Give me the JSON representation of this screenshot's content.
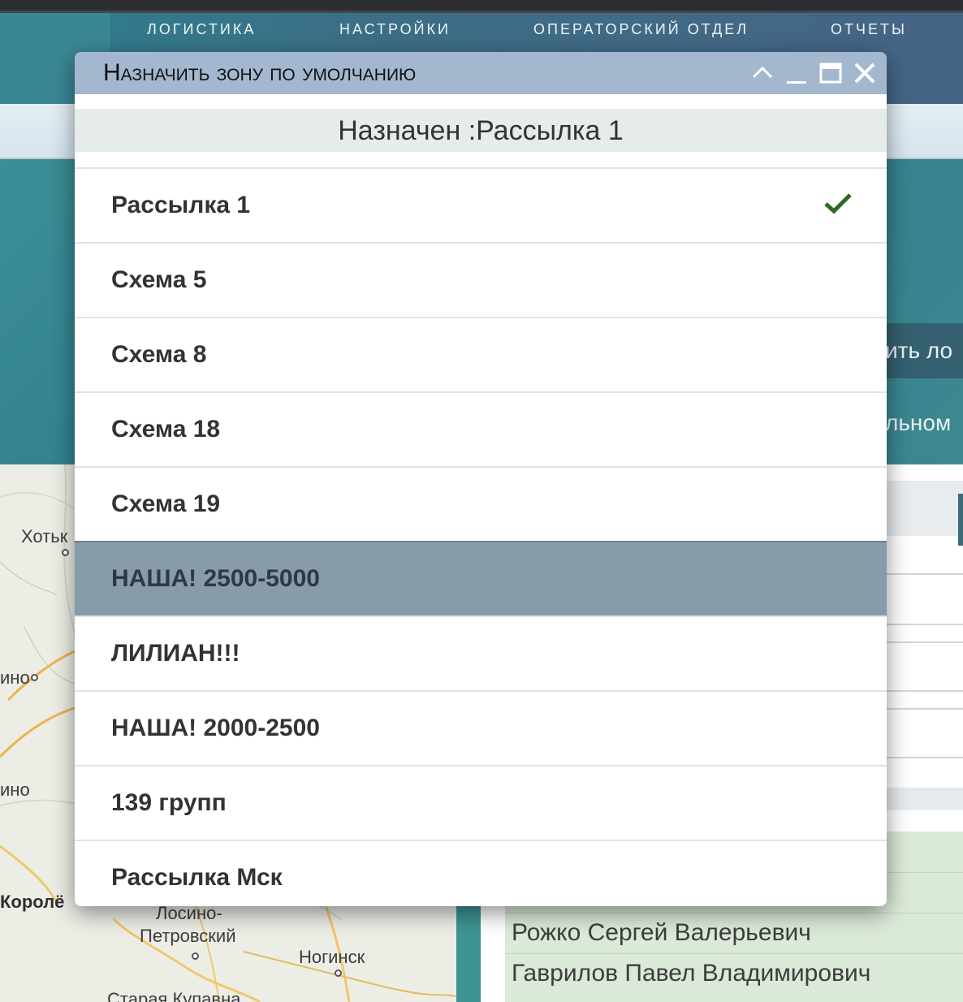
{
  "nav": {
    "items": [
      "ЛОГИСТИКА",
      "НАСТРОЙКИ",
      "ОПЕРАТОРСКИЙ ОТДЕЛ",
      "ОТЧЕТЫ"
    ]
  },
  "background": {
    "button_text": "ить ло",
    "side_text": "льном"
  },
  "map": {
    "labels": [
      "Хотьк",
      "ино",
      "ино",
      "Королё",
      "Лосино-",
      "Петровский",
      "Ногинск",
      "Старая Купавна"
    ]
  },
  "people": [
    "Рожко Сергей Валерьевич",
    "Гаврилов Павел Владимирович"
  ],
  "modal": {
    "title": "Назначить зону по умолчанию",
    "subtitle": "Назначен :Рассылка 1",
    "items": [
      {
        "label": "Рассылка 1",
        "checked": true
      },
      {
        "label": "Схема 5"
      },
      {
        "label": "Схема 8"
      },
      {
        "label": "Схема 18"
      },
      {
        "label": "Схема 19"
      },
      {
        "label": "НАША! 2500-5000",
        "highlighted": true
      },
      {
        "label": "ЛИЛИАН!!!"
      },
      {
        "label": "НАША! 2000-2500"
      },
      {
        "label": "139 групп"
      },
      {
        "label": "Рассылка Мск"
      }
    ]
  },
  "colors": {
    "title_bar": "#a3b7cf",
    "selected_row": "#879ba8",
    "check": "#2e6b1e",
    "teal": "#3f8f94"
  }
}
